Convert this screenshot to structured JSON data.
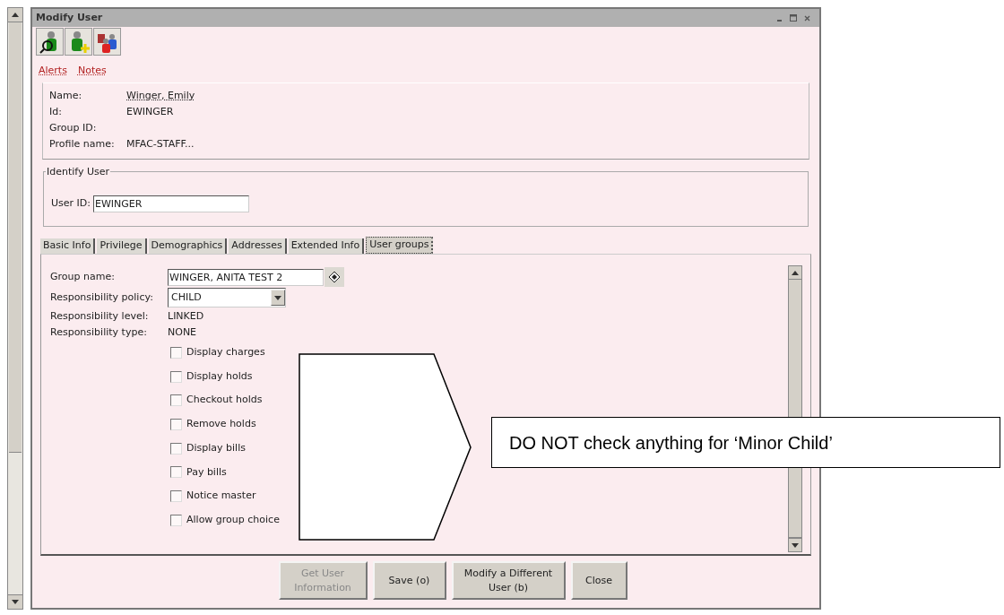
{
  "window": {
    "title": "Modify User"
  },
  "links": [
    "Alerts",
    "Notes"
  ],
  "info": [
    {
      "label": "Name:",
      "value": "Winger, Emily",
      "link": true
    },
    {
      "label": "Id:",
      "value": "EWINGER",
      "link": false
    },
    {
      "label": "Group ID:"
    },
    {
      "label": "Profile name:",
      "value": "MFAC-STAFF...",
      "link": false
    }
  ],
  "identify_user": {
    "legend": "Identify User",
    "label": "User ID:",
    "value": "EWINGER"
  },
  "tabs": [
    {
      "label": "Basic Info",
      "selected": false
    },
    {
      "label": "Privilege",
      "selected": false
    },
    {
      "label": "Demographics",
      "selected": false
    },
    {
      "label": "Addresses",
      "selected": false
    },
    {
      "label": "Extended Info",
      "selected": false
    },
    {
      "label": "User groups",
      "selected": true
    }
  ],
  "group_name": {
    "label": "Group name:",
    "value": "WINGER, ANITA TEST 2"
  },
  "responsibility_policy": {
    "label": "Responsibility policy:",
    "value": "CHILD"
  },
  "responsibility_level": {
    "label": "Responsibility level:",
    "value": "LINKED"
  },
  "responsibility_type": {
    "label": "Responsibility type:",
    "value": "NONE"
  },
  "checkboxes": [
    {
      "label": "Display charges",
      "checked": false
    },
    {
      "label": "Display holds",
      "checked": false
    },
    {
      "label": "Checkout holds",
      "checked": false
    },
    {
      "label": "Remove holds",
      "checked": false
    },
    {
      "label": "Display bills",
      "checked": false
    },
    {
      "label": "Pay bills",
      "checked": false
    },
    {
      "label": "Notice master",
      "checked": false
    },
    {
      "label": "Allow group choice",
      "checked": false
    }
  ],
  "buttons": [
    {
      "label": "Get User Information",
      "disabled": true
    },
    {
      "label": "Save (o)",
      "disabled": false
    },
    {
      "label": "Modify a Different User (b)",
      "disabled": false
    },
    {
      "label": "Close",
      "disabled": false
    }
  ],
  "callout": {
    "text": "DO NOT check anything for ‘Minor Child’"
  }
}
